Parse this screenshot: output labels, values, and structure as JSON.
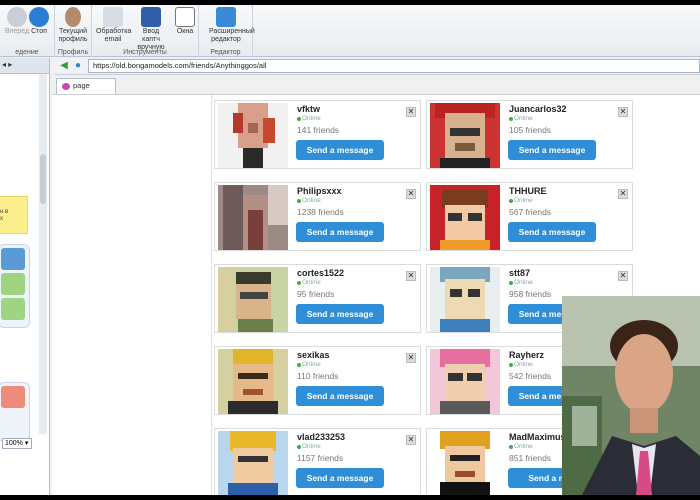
{
  "toolbar": {
    "forward_label": "Вперед",
    "stop_label": "Стоп",
    "group_labels": {
      "execution": "едение",
      "profile": "Профиль",
      "tools": "Инструменты",
      "editor": "Редактор"
    },
    "profile_label": "Текущий\nпрофиль",
    "email_label": "Обработка\nemail",
    "captcha_label": "Ввод каптч\nвручную",
    "windows_label": "Окна",
    "editor_label": "Расширенный\nредактор"
  },
  "address": {
    "url": "https://old.bongamodels.com/friends/Anythinggos/all"
  },
  "tab": {
    "label": "page"
  },
  "left_panel": {
    "sticky_text": "н в\nx",
    "zoom": "100%"
  },
  "friends": [
    {
      "name": "vfktw",
      "status": "Online",
      "friends": "141 friends",
      "button": "Send a message",
      "close": "✕"
    },
    {
      "name": "Juancarlos32",
      "status": "Online",
      "friends": "105 friends",
      "button": "Send a message",
      "close": "✕"
    },
    {
      "name": "Philipsxxx",
      "status": "Online",
      "friends": "1238 friends",
      "button": "Send a message",
      "close": "✕"
    },
    {
      "name": "THHURE",
      "status": "Online",
      "friends": "567 friends",
      "button": "Send a message",
      "close": "✕"
    },
    {
      "name": "cortes1522",
      "status": "Online",
      "friends": "95 friends",
      "button": "Send a message",
      "close": "✕"
    },
    {
      "name": "stt87",
      "status": "Online",
      "friends": "958 friends",
      "button": "Send a message",
      "close": "✕"
    },
    {
      "name": "sexikas",
      "status": "Online",
      "friends": "110 friends",
      "button": "Send a message",
      "close": "✕"
    },
    {
      "name": "Rayherz",
      "status": "Online",
      "friends": "542 friends",
      "button": "Send a message",
      "close": "✕"
    },
    {
      "name": "vlad233253",
      "status": "Online",
      "friends": "1157 friends",
      "button": "Send a message",
      "close": "✕"
    },
    {
      "name": "MadMaximus",
      "status": "Online",
      "friends": "851 friends",
      "button": "Send a mes",
      "close": "✕"
    }
  ],
  "colors": {
    "accent": "#2e8fd8",
    "online": "#3cb043"
  }
}
